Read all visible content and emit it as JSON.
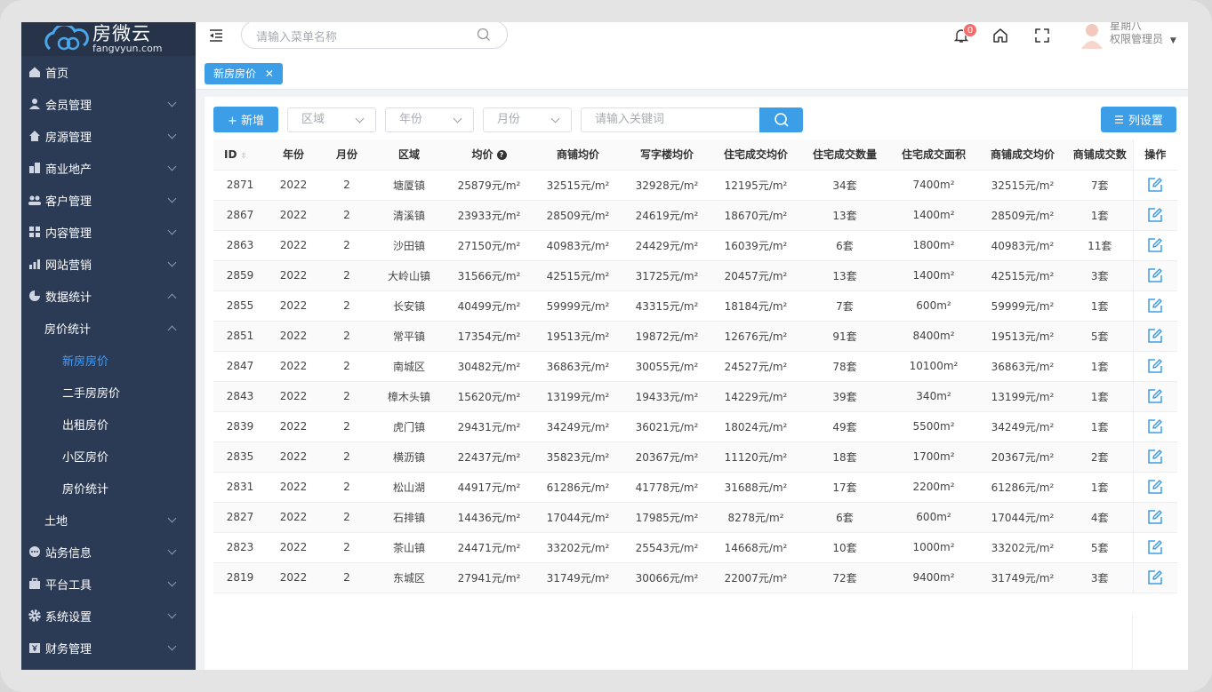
{
  "brand": {
    "name": "房微云",
    "domain": "fangvyun.com"
  },
  "topbar": {
    "search_placeholder": "请输入菜单名称",
    "notification_count": "0",
    "user_day": "星期八",
    "user_role": "权限管理员"
  },
  "sidebar": {
    "items": [
      {
        "label": "首页",
        "icon": "home-icon"
      },
      {
        "label": "会员管理",
        "icon": "user-icon"
      },
      {
        "label": "房源管理",
        "icon": "house-icon"
      },
      {
        "label": "商业地产",
        "icon": "building-icon"
      },
      {
        "label": "客户管理",
        "icon": "customers-icon"
      },
      {
        "label": "内容管理",
        "icon": "grid-icon"
      },
      {
        "label": "网站营销",
        "icon": "bar-chart-icon"
      },
      {
        "label": "数据统计",
        "icon": "pie-chart-icon"
      },
      {
        "label": "房价统计"
      },
      {
        "label": "新房房价"
      },
      {
        "label": "二手房房价"
      },
      {
        "label": "出租房价"
      },
      {
        "label": "小区房价"
      },
      {
        "label": "房价统计"
      },
      {
        "label": "土地"
      },
      {
        "label": "站务信息",
        "icon": "chat-icon"
      },
      {
        "label": "平台工具",
        "icon": "toolbox-icon"
      },
      {
        "label": "系统设置",
        "icon": "gear-icon"
      },
      {
        "label": "财务管理",
        "icon": "finance-icon"
      }
    ]
  },
  "tags": {
    "active": "新房房价"
  },
  "toolbar": {
    "add_label": "+ 新增",
    "region": "区域",
    "year": "年份",
    "month": "月份",
    "keyword_placeholder": "请输入关键词",
    "columns_label": "列设置"
  },
  "table": {
    "headers": [
      "ID",
      "年份",
      "月份",
      "区域",
      "均价",
      "商铺均价",
      "写字楼均价",
      "住宅成交均价",
      "住宅成交数量",
      "住宅成交面积",
      "商铺成交均价",
      "商铺成交数",
      "操作"
    ],
    "rows": [
      [
        "2871",
        "2022",
        "2",
        "塘厦镇",
        "25879元/m²",
        "32515元/m²",
        "32928元/m²",
        "12195元/m²",
        "34套",
        "7400m²",
        "32515元/m²",
        "7套"
      ],
      [
        "2867",
        "2022",
        "2",
        "清溪镇",
        "23933元/m²",
        "28509元/m²",
        "24619元/m²",
        "18670元/m²",
        "13套",
        "1400m²",
        "28509元/m²",
        "1套"
      ],
      [
        "2863",
        "2022",
        "2",
        "沙田镇",
        "27150元/m²",
        "40983元/m²",
        "24429元/m²",
        "16039元/m²",
        "6套",
        "1800m²",
        "40983元/m²",
        "11套"
      ],
      [
        "2859",
        "2022",
        "2",
        "大岭山镇",
        "31566元/m²",
        "42515元/m²",
        "31725元/m²",
        "20457元/m²",
        "13套",
        "1400m²",
        "42515元/m²",
        "3套"
      ],
      [
        "2855",
        "2022",
        "2",
        "长安镇",
        "40499元/m²",
        "59999元/m²",
        "43315元/m²",
        "18184元/m²",
        "7套",
        "600m²",
        "59999元/m²",
        "1套"
      ],
      [
        "2851",
        "2022",
        "2",
        "常平镇",
        "17354元/m²",
        "19513元/m²",
        "19872元/m²",
        "12676元/m²",
        "91套",
        "8400m²",
        "19513元/m²",
        "5套"
      ],
      [
        "2847",
        "2022",
        "2",
        "南城区",
        "30482元/m²",
        "36863元/m²",
        "30055元/m²",
        "24527元/m²",
        "78套",
        "10100m²",
        "36863元/m²",
        "1套"
      ],
      [
        "2843",
        "2022",
        "2",
        "樟木头镇",
        "15620元/m²",
        "13199元/m²",
        "19433元/m²",
        "14229元/m²",
        "39套",
        "340m²",
        "13199元/m²",
        "1套"
      ],
      [
        "2839",
        "2022",
        "2",
        "虎门镇",
        "29431元/m²",
        "34249元/m²",
        "36021元/m²",
        "18024元/m²",
        "49套",
        "5500m²",
        "34249元/m²",
        "1套"
      ],
      [
        "2835",
        "2022",
        "2",
        "横沥镇",
        "22437元/m²",
        "35823元/m²",
        "20367元/m²",
        "11120元/m²",
        "18套",
        "1700m²",
        "20367元/m²",
        "2套"
      ],
      [
        "2831",
        "2022",
        "2",
        "松山湖",
        "44917元/m²",
        "61286元/m²",
        "41778元/m²",
        "31688元/m²",
        "17套",
        "2200m²",
        "61286元/m²",
        "1套"
      ],
      [
        "2827",
        "2022",
        "2",
        "石排镇",
        "14436元/m²",
        "17044元/m²",
        "17985元/m²",
        "8278元/m²",
        "6套",
        "600m²",
        "17044元/m²",
        "4套"
      ],
      [
        "2823",
        "2022",
        "2",
        "茶山镇",
        "24471元/m²",
        "33202元/m²",
        "25543元/m²",
        "14668元/m²",
        "10套",
        "1000m²",
        "33202元/m²",
        "5套"
      ],
      [
        "2819",
        "2022",
        "2",
        "东城区",
        "27941元/m²",
        "31749元/m²",
        "30066元/m²",
        "22007元/m²",
        "72套",
        "9400m²",
        "31749元/m²",
        "3套"
      ]
    ]
  },
  "colors": {
    "sidebar_bg": "#2c3b55",
    "accent": "#3d9ee8",
    "active_menu": "#409eff",
    "badge": "#f56c6c"
  }
}
